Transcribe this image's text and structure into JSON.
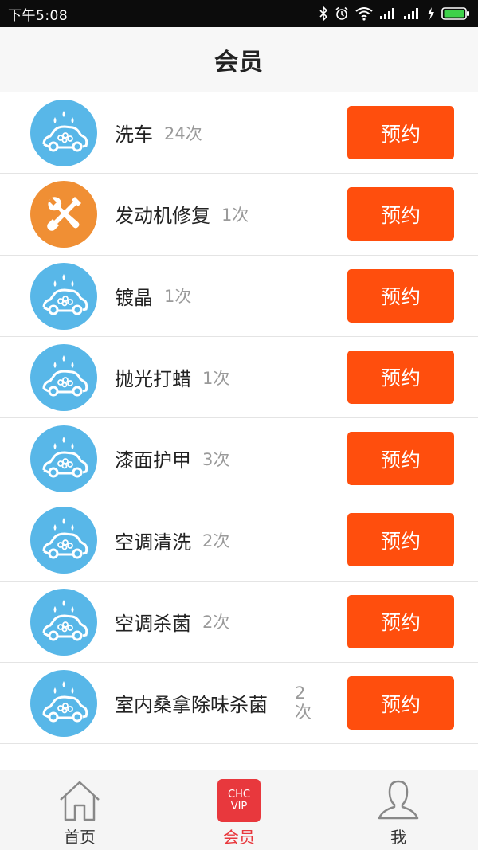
{
  "status_bar": {
    "time": "下午5:08"
  },
  "header": {
    "title": "会员"
  },
  "services": [
    {
      "name": "洗车",
      "count": "24次",
      "icon": "car-wash-icon",
      "action": "预约"
    },
    {
      "name": "发动机修复",
      "count": "1次",
      "icon": "wrench-screwdriver-icon",
      "action": "预约"
    },
    {
      "name": "镀晶",
      "count": "1次",
      "icon": "car-wash-icon",
      "action": "预约"
    },
    {
      "name": "抛光打蜡",
      "count": "1次",
      "icon": "car-wash-icon",
      "action": "预约"
    },
    {
      "name": "漆面护甲",
      "count": "3次",
      "icon": "car-wash-icon",
      "action": "预约"
    },
    {
      "name": "空调清洗",
      "count": "2次",
      "icon": "car-wash-icon",
      "action": "预约"
    },
    {
      "name": "空调杀菌",
      "count": "2次",
      "icon": "car-wash-icon",
      "action": "预约"
    },
    {
      "name": "室内桑拿除味杀菌",
      "count": "2次",
      "icon": "car-wash-icon",
      "action": "预约"
    }
  ],
  "tabs": [
    {
      "label": "首页",
      "icon": "home-icon",
      "active": false
    },
    {
      "label": "会员",
      "icon": "vip-icon",
      "active": true,
      "badge_top": "CHC",
      "badge_bottom": "VIP"
    },
    {
      "label": "我",
      "icon": "profile-icon",
      "active": false
    }
  ],
  "colors": {
    "accent": "#ff4e0d",
    "icon_blue": "#58b7e8",
    "icon_orange": "#f08f34",
    "tab_active": "#e8383d"
  }
}
